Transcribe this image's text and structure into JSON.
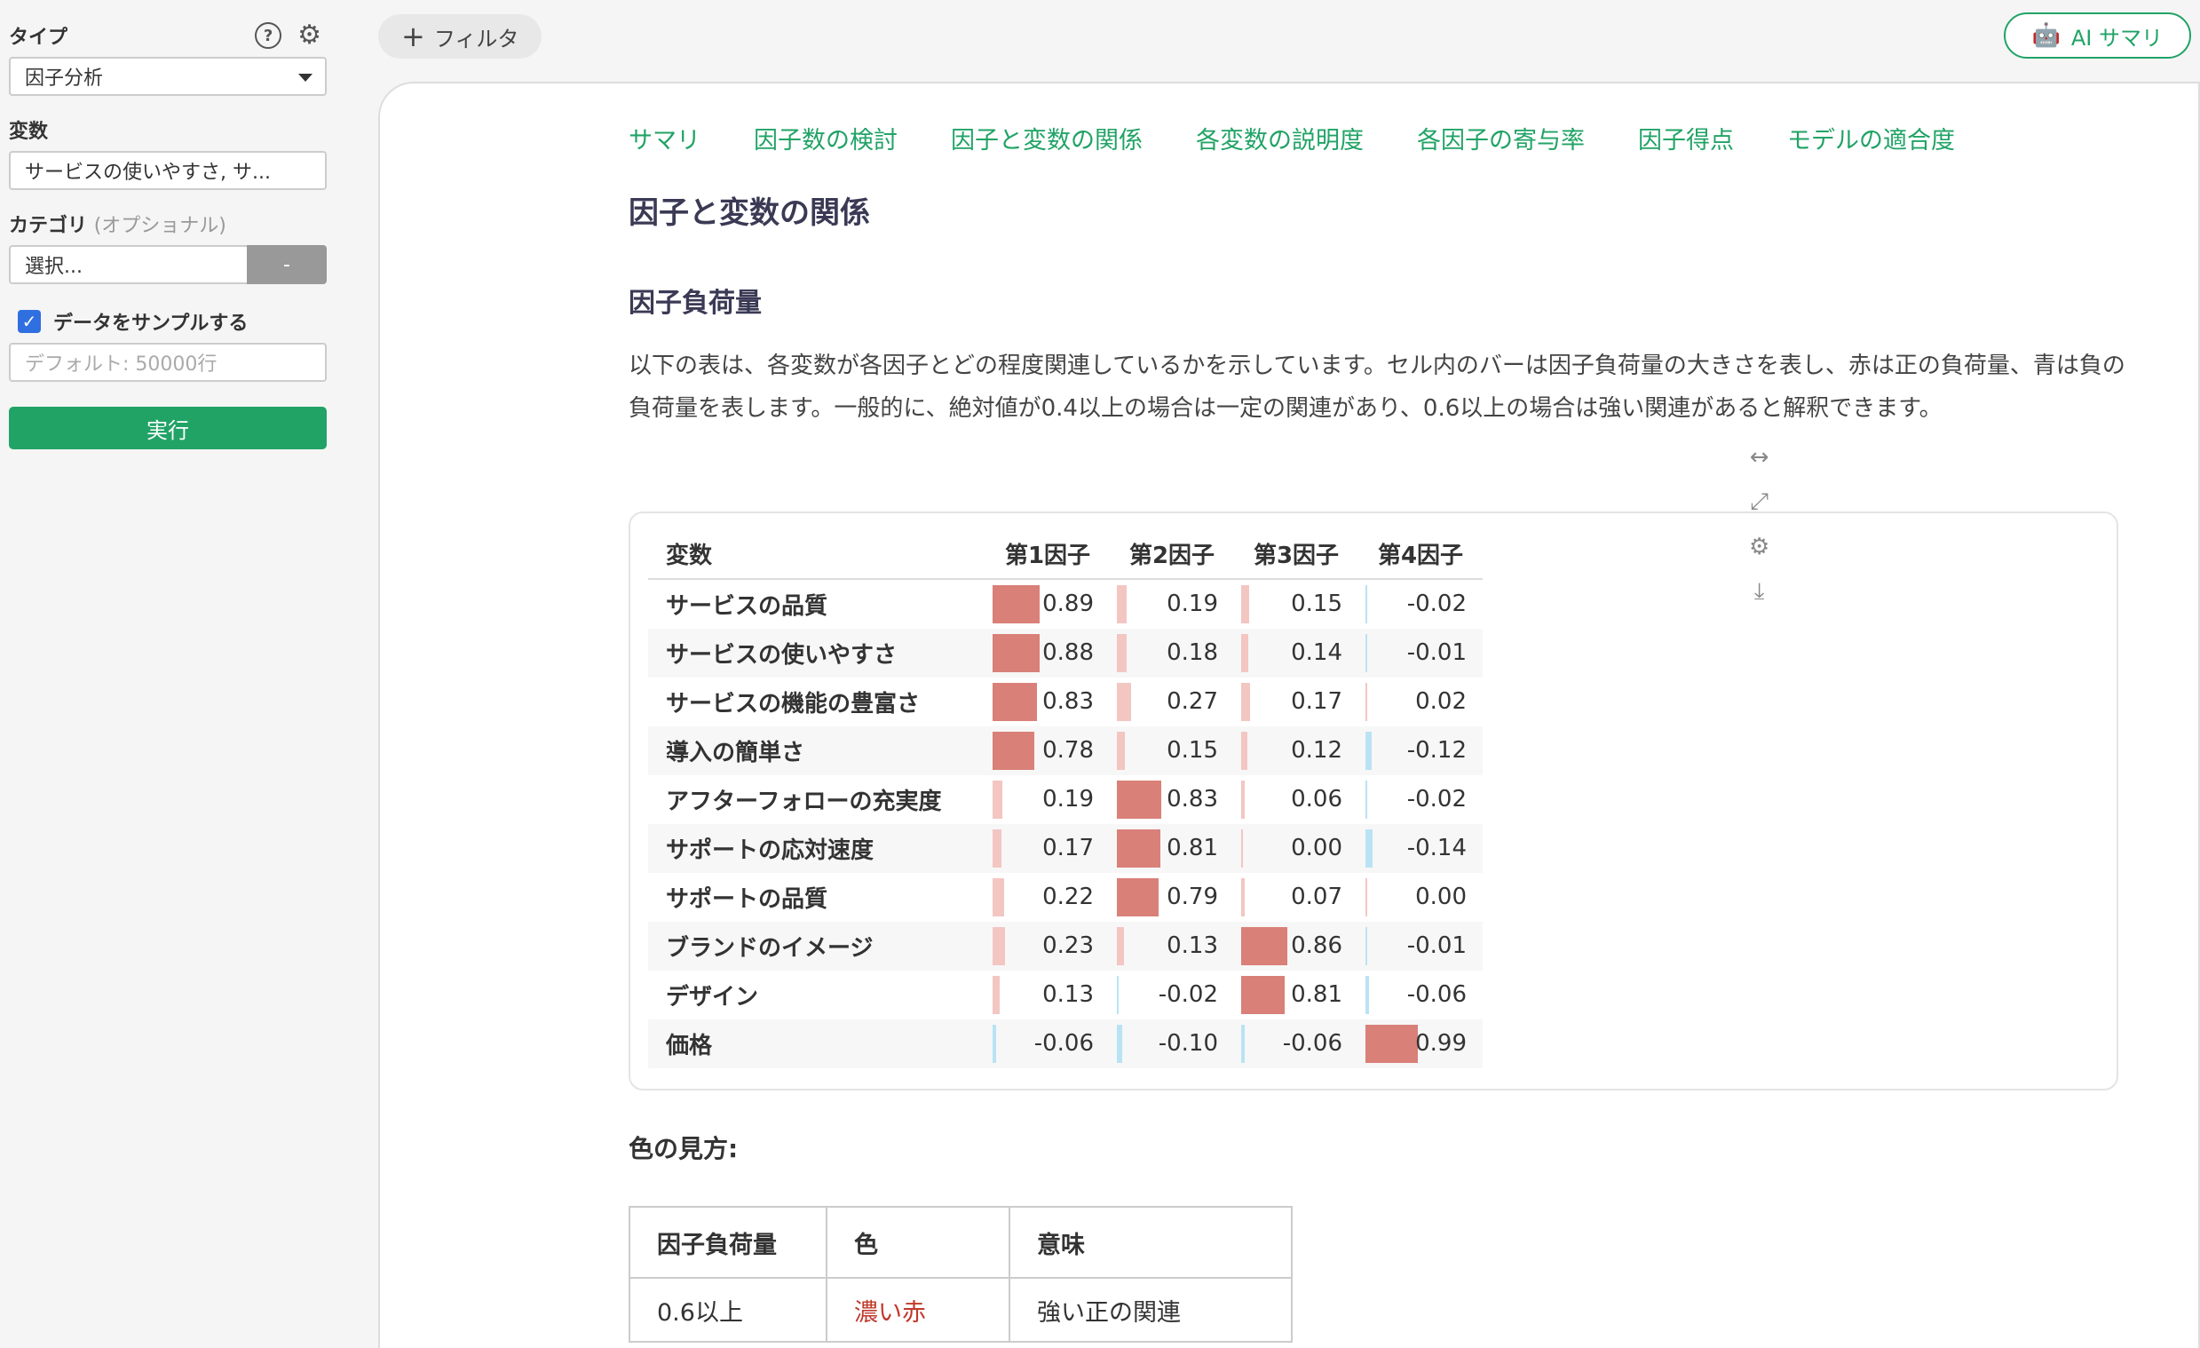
{
  "sidebar": {
    "type_label": "タイプ",
    "type_value": "因子分析",
    "variables_label": "変数",
    "variables_value": "サービスの使いやすさ, サ...",
    "category_label": "カテゴリ",
    "category_optional": "(オプショナル)",
    "category_placeholder": "選択...",
    "category_button": "-",
    "sample_label": "データをサンプルする",
    "sample_placeholder": "デフォルト: 50000行",
    "run_label": "実行"
  },
  "topbar": {
    "filter_label": "フィルタ",
    "ai_label": "AI サマリ"
  },
  "tabs": [
    "サマリ",
    "因子数の検討",
    "因子と変数の関係",
    "各変数の説明度",
    "各因子の寄与率",
    "因子得点",
    "モデルの適合度"
  ],
  "main": {
    "title": "因子と変数の関係",
    "subtitle": "因子負荷量",
    "description": "以下の表は、各変数が各因子とどの程度関連しているかを示しています。セル内のバーは因子負荷量の大きさを表し、赤は正の負荷量、青は負の負荷量を表します。一般的に、絶対値が0.4以上の場合は一定の関連があり、0.6以上の場合は強い関連があると解釈できます。",
    "color_guide_title": "色の見方:"
  },
  "loadings": {
    "headers": [
      "変数",
      "第1因子",
      "第2因子",
      "第3因子",
      "第4因子"
    ],
    "rows": [
      {
        "name": "サービスの品質",
        "values": [
          "0.89",
          "0.19",
          "0.15",
          "-0.02"
        ]
      },
      {
        "name": "サービスの使いやすさ",
        "values": [
          "0.88",
          "0.18",
          "0.14",
          "-0.01"
        ]
      },
      {
        "name": "サービスの機能の豊富さ",
        "values": [
          "0.83",
          "0.27",
          "0.17",
          "0.02"
        ]
      },
      {
        "name": "導入の簡単さ",
        "values": [
          "0.78",
          "0.15",
          "0.12",
          "-0.12"
        ]
      },
      {
        "name": "アフターフォローの充実度",
        "values": [
          "0.19",
          "0.83",
          "0.06",
          "-0.02"
        ]
      },
      {
        "name": "サポートの応対速度",
        "values": [
          "0.17",
          "0.81",
          "0.00",
          "-0.14"
        ]
      },
      {
        "name": "サポートの品質",
        "values": [
          "0.22",
          "0.79",
          "0.07",
          "0.00"
        ]
      },
      {
        "name": "ブランドのイメージ",
        "values": [
          "0.23",
          "0.13",
          "0.86",
          "-0.01"
        ]
      },
      {
        "name": "デザイン",
        "values": [
          "0.13",
          "-0.02",
          "0.81",
          "-0.06"
        ]
      },
      {
        "name": "価格",
        "values": [
          "-0.06",
          "-0.10",
          "-0.06",
          "0.99"
        ]
      }
    ]
  },
  "color_guide": {
    "headers": [
      "因子負荷量",
      "色",
      "意味"
    ],
    "rows": [
      {
        "range": "0.6以上",
        "color": "濃い赤",
        "meaning": "強い正の関連"
      }
    ]
  },
  "colors": {
    "accent": "#21a366",
    "strong_positive": "#d98078",
    "weak_positive": "#f3c6c2",
    "negative": "#b9e3f4"
  }
}
